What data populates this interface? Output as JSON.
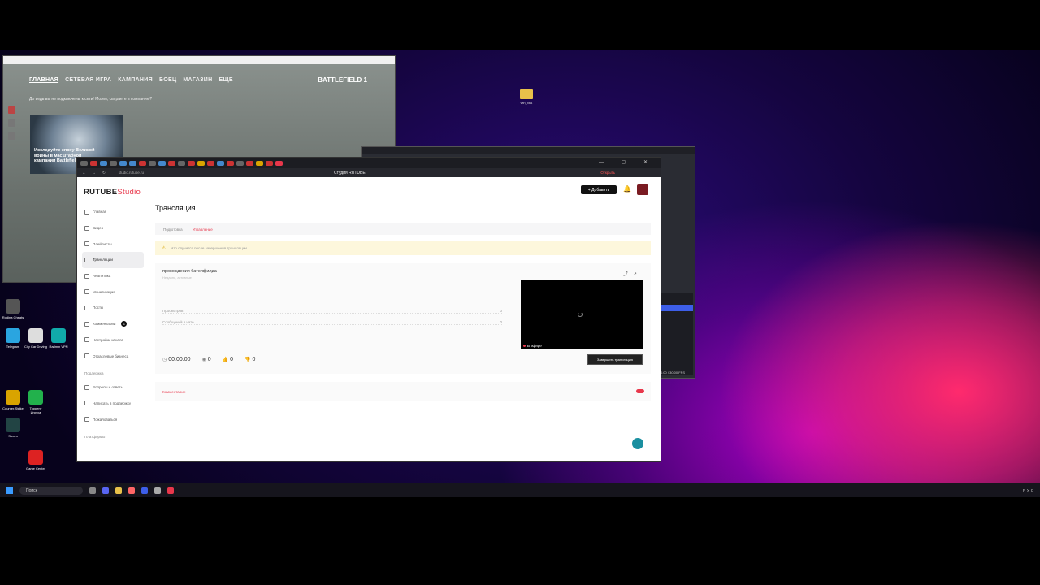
{
  "colors": {
    "accent": "#e8374b",
    "wallpaper_pink": "#ff2a6d",
    "wallpaper_purple": "#b000c8",
    "obs_highlight": "#3d5ee8"
  },
  "desktop": {
    "folder": {
      "label": "win_x64"
    },
    "icons": [
      {
        "label": "Rodina Cheats",
        "icon": "app-icon",
        "color": "#555"
      },
      {
        "label": "Telegram",
        "icon": "telegram-icon",
        "color": "#2aa5e0"
      },
      {
        "label": "City Car Driving",
        "icon": "file-icon",
        "color": "#ddd"
      },
      {
        "label": "Radmin VPN",
        "icon": "vpn-icon",
        "color": "#1aa"
      },
      {
        "label": "Counter-Strike",
        "icon": "cs-icon",
        "color": "#d9a400"
      },
      {
        "label": "Торрент Игруха",
        "icon": "torrent-icon",
        "color": "#22b14c"
      },
      {
        "label": "Steam",
        "icon": "steam-icon",
        "color": "#244"
      },
      {
        "label": "Game Center",
        "icon": "game-center-icon",
        "color": "#d22"
      }
    ]
  },
  "battlefield": {
    "nav": [
      "ГЛАВНАЯ",
      "СЕТЕВАЯ ИГРА",
      "КАМПАНИЯ",
      "БОЕЦ",
      "МАГАЗИН",
      "ЕЩЕ"
    ],
    "logo": "BATTLEFIELD 1",
    "message": "До ведь вы не подключены к сети! Может, сыграете в компанию?",
    "card_text": "Исследуйте эпоху Великой войны в масштабной кампании Battlefield 1"
  },
  "obs": {
    "fps": "0.00 / 30.00 FPS"
  },
  "browser": {
    "url": "studio.rutube.ru",
    "page_title": "Студия RUTUBE",
    "share_label": "Открыть",
    "window_controls": "— ▢ ✕"
  },
  "studio": {
    "logo_main": "RUTUBE",
    "logo_suffix": "Studio",
    "add_button": "Добавить",
    "sidebar": [
      {
        "label": "Главная",
        "active": false
      },
      {
        "label": "Видео",
        "active": false
      },
      {
        "label": "Плейлисты",
        "active": false
      },
      {
        "label": "Трансляции",
        "active": true
      },
      {
        "label": "Аналитика",
        "active": false
      },
      {
        "label": "Монетизация",
        "active": false
      },
      {
        "label": "Посты",
        "active": false
      },
      {
        "label": "Комментарии",
        "active": false,
        "badge": "1"
      },
      {
        "label": "Настройки канала",
        "active": false
      },
      {
        "label": "Отраслевые бизнеса",
        "active": false
      }
    ],
    "support_section": "Поддержка",
    "support_items": [
      "Вопросы и ответы",
      "Написать в поддержку",
      "Пожаловаться"
    ],
    "platforms_section": "Платформы",
    "page_title": "Трансляция",
    "subtabs": [
      "Подготовка",
      "Управление"
    ],
    "warning": "Что случится после завершения трансляции",
    "stream_title": "прохождения бателфилда",
    "stream_sub": "Недавно, активные",
    "rows": [
      {
        "label": "Просмотров",
        "value": "0"
      },
      {
        "label": "Сообщений в чате",
        "value": "0"
      }
    ],
    "live_label": "В эфире",
    "stop_button": "Завершить трансляцию",
    "timer": "00:00:00",
    "views": "0",
    "likes": "0",
    "dislikes": "0",
    "comments_label": "Комментарии"
  },
  "taskbar": {
    "search": "Поиск",
    "tray": "РУС"
  }
}
